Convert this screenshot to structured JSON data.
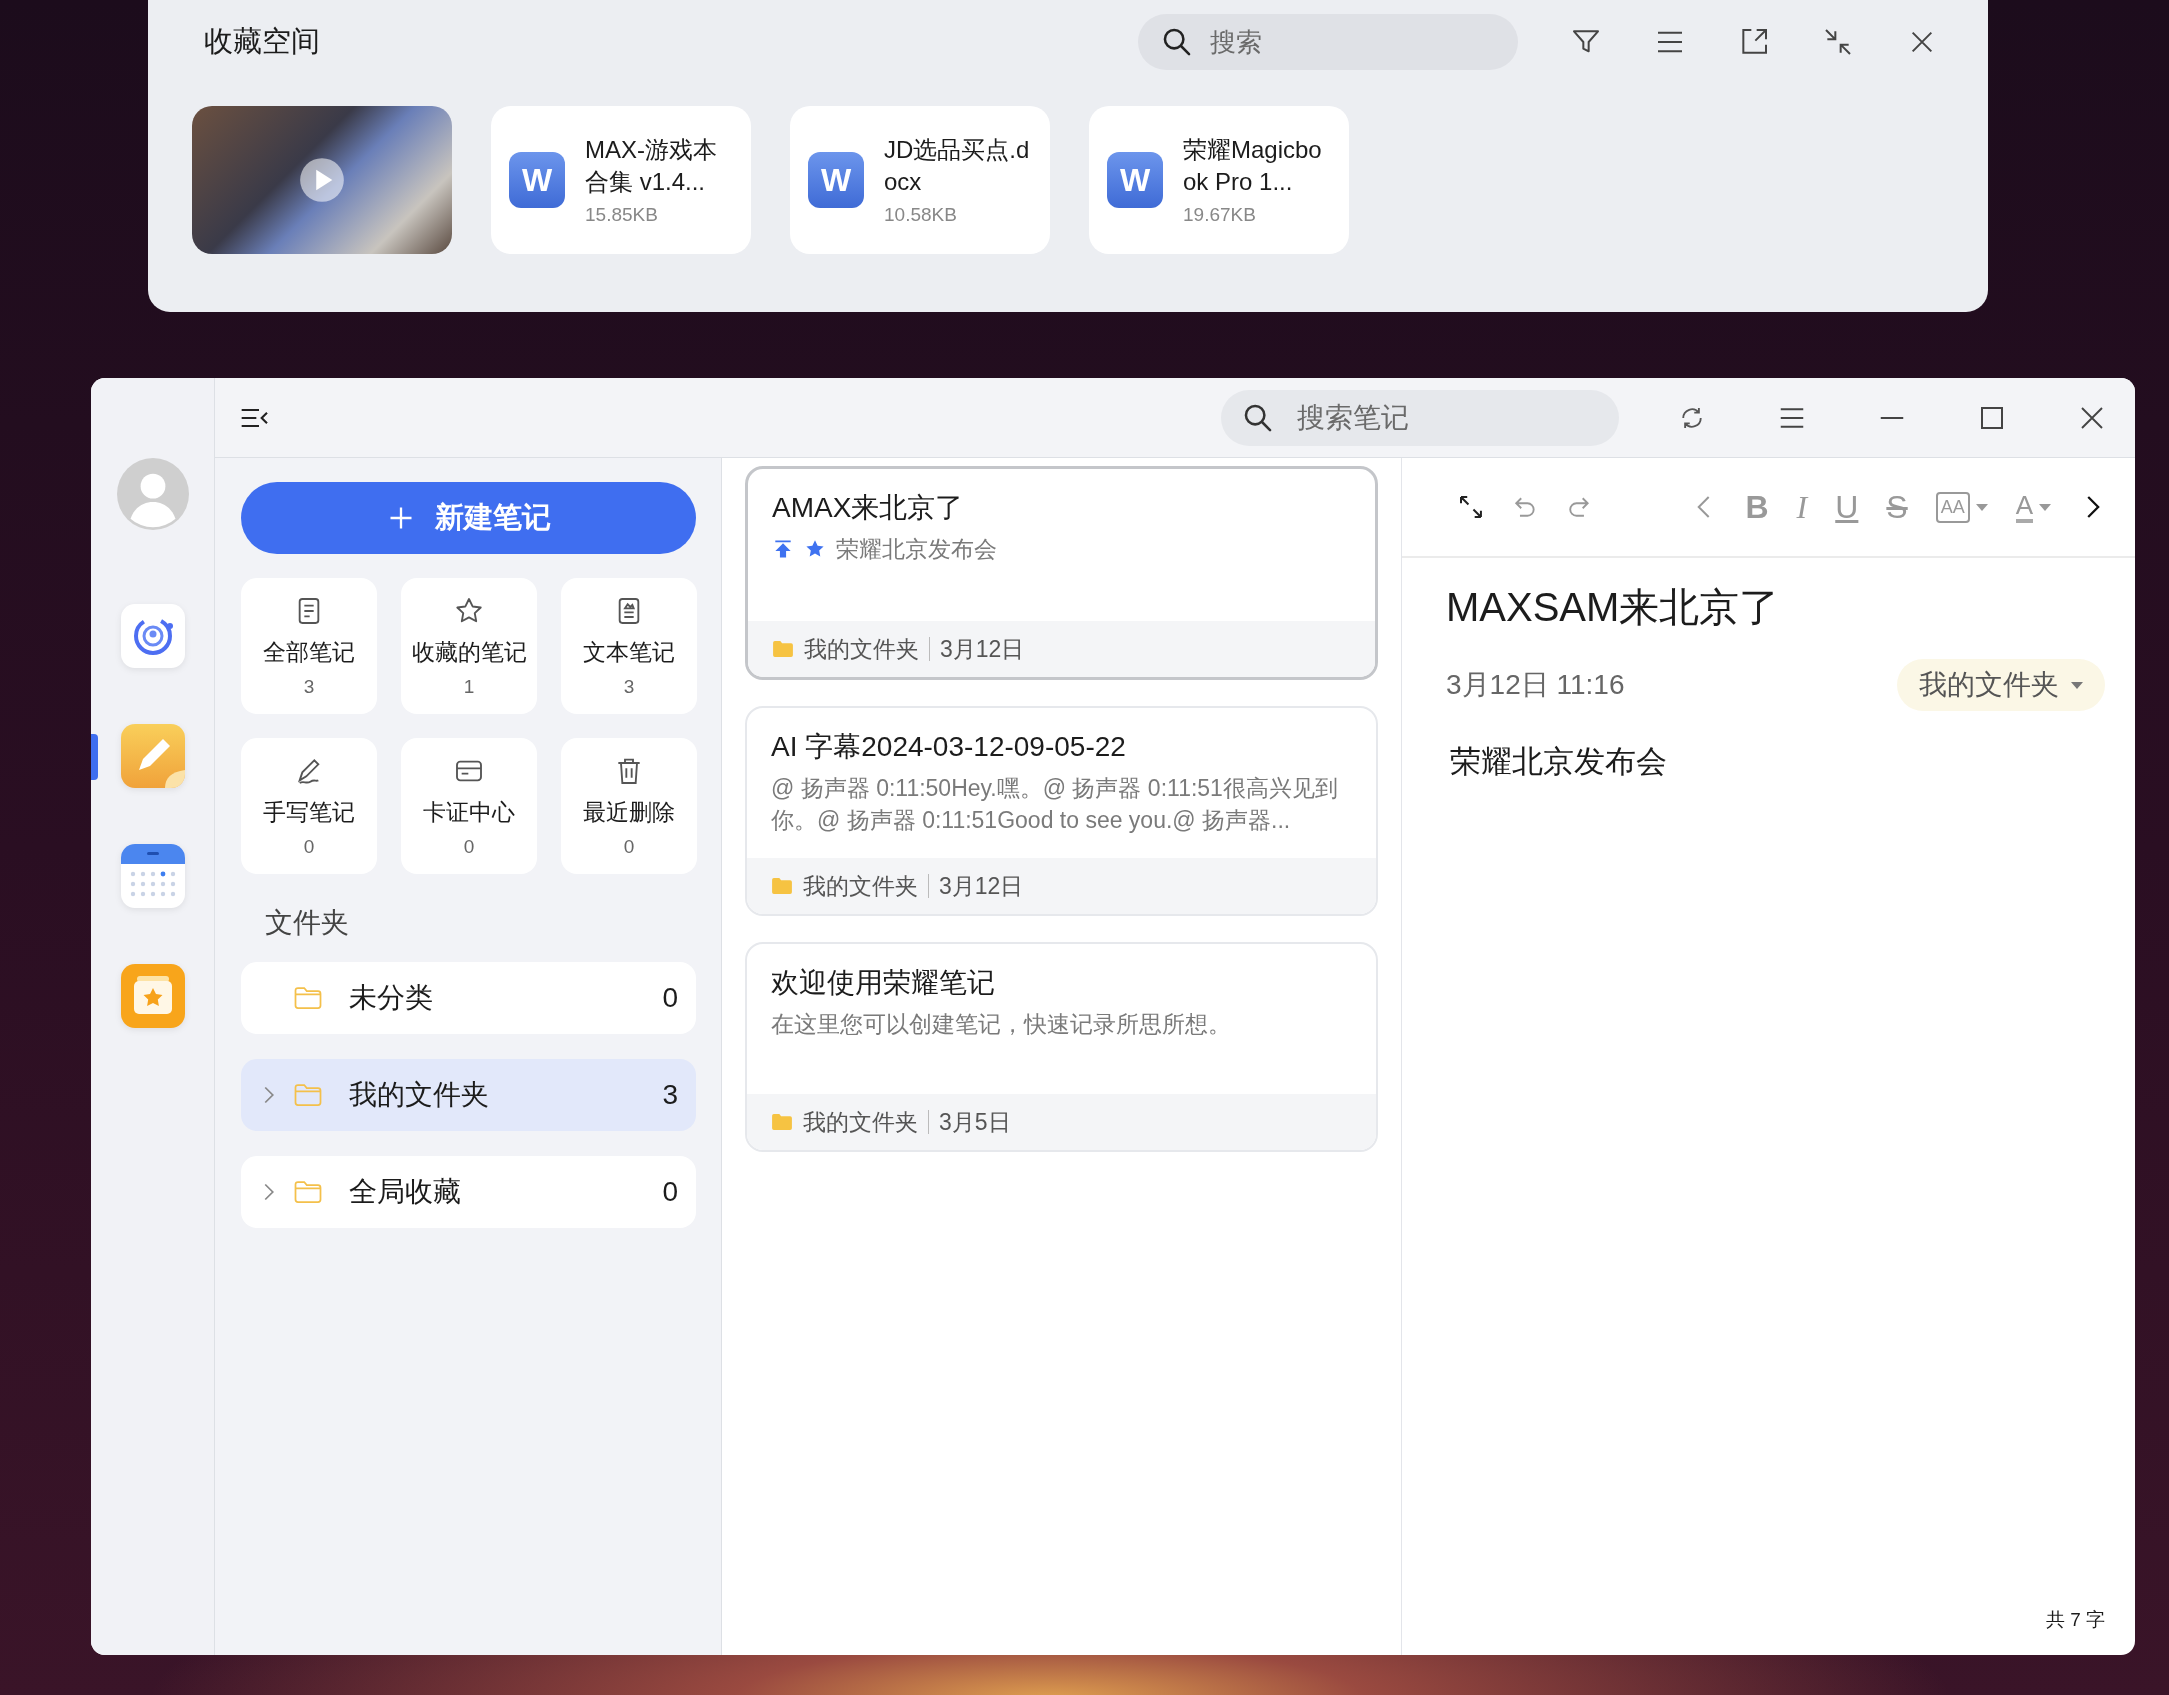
{
  "favorites_panel": {
    "title": "收藏空间",
    "search": {
      "placeholder": "搜索"
    },
    "items": [
      {
        "kind": "video"
      },
      {
        "kind": "doc",
        "icon_letter": "W",
        "name": "MAX-游戏本合集 v1.4...",
        "size": "15.85KB"
      },
      {
        "kind": "doc",
        "icon_letter": "W",
        "name": "JD选品买点.docx",
        "size": "10.58KB"
      },
      {
        "kind": "doc",
        "icon_letter": "W",
        "name": "荣耀Magicbook Pro 1...",
        "size": "19.67KB"
      }
    ]
  },
  "rail": {
    "items": [
      {
        "kind": "assistant",
        "selected": false
      },
      {
        "kind": "notes",
        "selected": true
      },
      {
        "kind": "calendar",
        "selected": false
      },
      {
        "kind": "favorites",
        "selected": false
      }
    ]
  },
  "header": {
    "search": {
      "placeholder": "搜索笔记"
    }
  },
  "sidebar": {
    "new_button": "新建笔记",
    "categories": [
      {
        "kind": "document",
        "label": "全部笔记",
        "count": "3"
      },
      {
        "kind": "star",
        "label": "收藏的笔记",
        "count": "1"
      },
      {
        "kind": "text",
        "label": "文本笔记",
        "count": "3"
      },
      {
        "kind": "pen",
        "label": "手写笔记",
        "count": "0"
      },
      {
        "kind": "card",
        "label": "卡证中心",
        "count": "0"
      },
      {
        "kind": "trash",
        "label": "最近删除",
        "count": "0"
      }
    ],
    "folders_heading": "文件夹",
    "folders": [
      {
        "name": "未分类",
        "count": "0",
        "expandable": false,
        "selected": false
      },
      {
        "name": "我的文件夹",
        "count": "3",
        "expandable": true,
        "selected": true
      },
      {
        "name": "全局收藏",
        "count": "0",
        "expandable": true,
        "selected": false
      }
    ]
  },
  "notes": [
    {
      "title": "AMAX来北京了",
      "pinned": true,
      "starred": true,
      "preview": "荣耀北京发布会",
      "folder": "我的文件夹",
      "date": "3月12日",
      "selected": true
    },
    {
      "title": "AI 字幕2024-03-12-09-05-22",
      "pinned": false,
      "starred": false,
      "preview": "@ 扬声器 0:11:50Hey.嘿。@ 扬声器 0:11:51很高兴见到你。@ 扬声器 0:11:51Good to see you.@ 扬声器...",
      "folder": "我的文件夹",
      "date": "3月12日",
      "selected": false
    },
    {
      "title": "欢迎使用荣耀笔记",
      "pinned": false,
      "starred": false,
      "preview": "在这里您可以创建笔记，快速记录所思所想。",
      "folder": "我的文件夹",
      "date": "3月5日",
      "selected": false
    }
  ],
  "editor": {
    "format_buttons": [
      {
        "kind": "bold",
        "label": "B"
      },
      {
        "kind": "italic",
        "label": "I"
      },
      {
        "kind": "underline",
        "label": "U"
      },
      {
        "kind": "strike",
        "label": "S"
      },
      {
        "kind": "size",
        "label": "AA"
      },
      {
        "kind": "color",
        "label": "A"
      }
    ],
    "title": "MAXSAM来北京了",
    "datetime": "3月12日 11:16",
    "folder": "我的文件夹",
    "body": "荣耀北京发布会",
    "word_count": "共 7 字"
  }
}
